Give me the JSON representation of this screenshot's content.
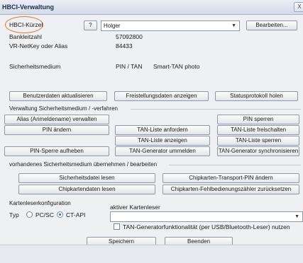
{
  "window": {
    "title": "HBCI-Verwaltung",
    "close_label": "X"
  },
  "header": {
    "hbci_label": "HBCI-Kürzel",
    "help_label": "?",
    "user_select": {
      "value": "Holger"
    },
    "edit_button": "Bearbeiten..."
  },
  "info": {
    "bankleitzahl_label": "Bankleitzahl",
    "bankleitzahl_value": "57092800",
    "netkey_label": "VR-NetKey oder Alias",
    "netkey_value": "84433",
    "medium_label": "Sicherheitsmedium",
    "medium_value": "PIN / TAN",
    "medium_extra": "Smart-TAN photo"
  },
  "actions": {
    "userdata_update": "Benutzerdaten aktualisieren",
    "exemption_show": "Freistellungsdaten anzeigen",
    "status_fetch": "Statusprotokoll holen"
  },
  "medium_mgmt": {
    "group_label": "Verwaltung Sicherheitsmedium / -verfahren",
    "alias_manage": "Alias (Anmeldename) verwalten",
    "pin_lock": "PIN sperren",
    "pin_change": "PIN ändern",
    "tan_request": "TAN-Liste anfordern",
    "tan_unlock": "TAN-Liste freischalten",
    "tan_show": "TAN-Liste anzeigen",
    "tan_lock": "TAN-Liste sperren",
    "pin_unlock": "PIN-Sperre aufheben",
    "tan_gen_rename": "TAN-Generator ummelden",
    "tan_gen_sync": "TAN-Generator synchronisieren"
  },
  "existing_medium": {
    "group_label": "vorhandenes Sicherheitsmedium übernehmen / bearbeiten",
    "file_read": "Sicherheitsdatei lesen",
    "chip_transport": "Chipkarten-Transport-PIN ändern",
    "chipdata_read": "Chipkartendaten lesen",
    "chip_error_reset": "Chipkarten-Fehlbedienungszähler zurücksetzen"
  },
  "reader": {
    "config_label": "Kartenleserkonfiguration",
    "type_label": "Typ",
    "pcsc_label": "PC/SC",
    "ctapi_label": "CT-API",
    "active_reader_label": "aktiver Kartenleser",
    "active_reader_value": "",
    "tan_gen_checkbox": "TAN-Generatorfunktionalität (per USB/Bluetooth-Leser) nutzen"
  },
  "footer": {
    "save_label": "Speichern",
    "quit_label": "Beenden"
  }
}
